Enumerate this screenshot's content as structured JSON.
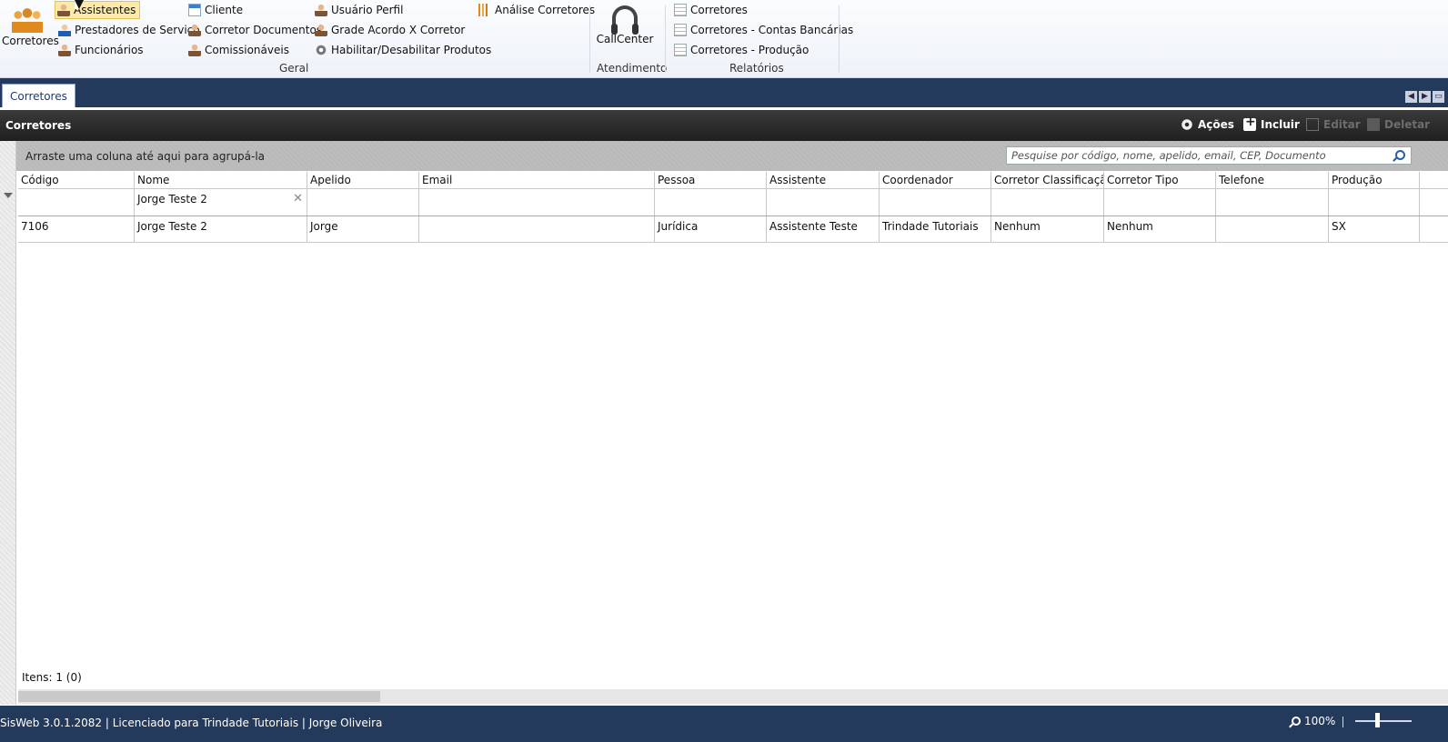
{
  "ribbon": {
    "corretores_big": "Corretores",
    "geral": {
      "label": "Geral",
      "col1": [
        "Assistentes",
        "Prestadores de Serviço",
        "Funcionários"
      ],
      "col2": [
        "Cliente",
        "Corretor Documentos",
        "Comissionáveis"
      ],
      "col3": [
        "Usuário Perfil",
        "Grade Acordo X Corretor",
        "Habilitar/Desabilitar Produtos"
      ],
      "col4": [
        "Análise Corretores"
      ]
    },
    "atendimento": {
      "label": "Atendimento",
      "callcenter": "CallCenter"
    },
    "relatorios": {
      "label": "Relatórios",
      "items": [
        "Corretores",
        "Corretores - Contas Bancárias",
        "Corretores - Produção"
      ]
    }
  },
  "tabbar": {
    "active_tab": "Corretores"
  },
  "panel": {
    "title": "Corretores",
    "toolbar": {
      "acoes": "Ações",
      "incluir": "Incluir",
      "editar": "Editar",
      "deletar": "Deletar"
    }
  },
  "grid": {
    "group_hint": "Arraste uma coluna até aqui para agrupá-la",
    "search_placeholder": "Pesquise por código, nome, apelido, email, CEP, Documento",
    "columns": [
      "Código",
      "Nome",
      "Apelido",
      "Email",
      "Pessoa",
      "Assistente",
      "Coordenador",
      "Corretor Classificação",
      "Corretor Tipo",
      "Telefone",
      "Produção"
    ],
    "filter": {
      "nome": "Jorge Teste 2"
    },
    "rows": [
      [
        "7106",
        "Jorge Teste 2",
        "Jorge",
        "",
        "Jurídica",
        "Assistente Teste",
        "Trindade Tutoriais",
        "Nenhum",
        "Nenhum",
        "",
        "SX"
      ]
    ],
    "items_count": "Itens: 1 (0)"
  },
  "status": {
    "text": "SisWeb 3.0.1.2082 | Licenciado para Trindade Tutoriais | Jorge Oliveira",
    "zoom": "100%"
  }
}
